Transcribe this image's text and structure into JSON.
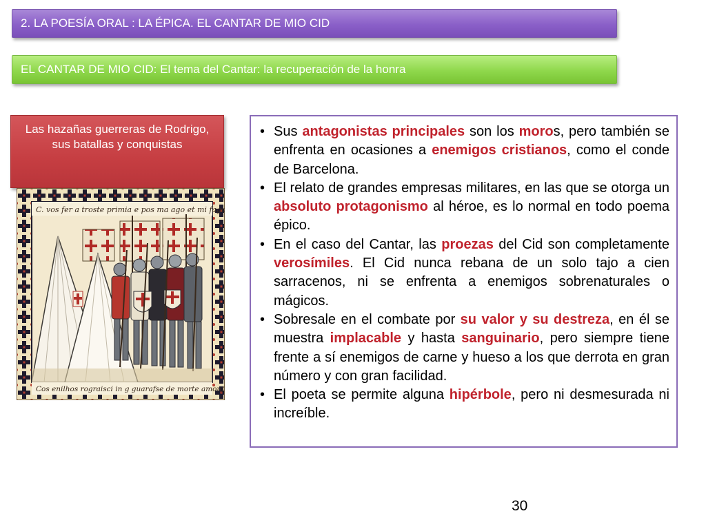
{
  "header": {
    "title": "2. LA POESÍA ORAL : LA ÉPICA. EL CANTAR DE MIO CID",
    "subtitle": "EL CANTAR DE MIO CID: El tema del Cantar: la recuperación de la honra"
  },
  "caption": "Las hazañas guerreras de Rodrigo, sus batallas y conquistas",
  "illustration": {
    "top_inscription": "C. vos fer a troste primia e pos ma ago et mi fago",
    "bottom_inscription": "Cos enilhos rograisci in g guarafse de morte amouf ie"
  },
  "bullets": [
    [
      {
        "t": "Sus "
      },
      {
        "t": "antagonistas principales",
        "hl": true
      },
      {
        "t": " son los "
      },
      {
        "t": "moro",
        "hl": true
      },
      {
        "t": "s, pero también se enfrenta en ocasiones a "
      },
      {
        "t": "enemigos cristianos",
        "hl": true
      },
      {
        "t": ", como el conde de Barcelona."
      }
    ],
    [
      {
        "t": "El relato de grandes empresas militares, en las que se otorga un "
      },
      {
        "t": "absoluto protagonismo",
        "hl": true
      },
      {
        "t": " al héroe, es lo normal en todo poema épico."
      }
    ],
    [
      {
        "t": "En el caso del Cantar, las "
      },
      {
        "t": "proezas",
        "hl": true
      },
      {
        "t": " del Cid son completamente "
      },
      {
        "t": "verosímiles",
        "hl": true
      },
      {
        "t": ". El Cid nunca rebana de un solo tajo a cien sarracenos, ni se enfrenta a enemigos sobrenaturales o mágicos."
      }
    ],
    [
      {
        "t": "Sobresale en el combate por "
      },
      {
        "t": "su valor y su destreza",
        "hl": true
      },
      {
        "t": ", en él se muestra "
      },
      {
        "t": "implacable",
        "hl": true
      },
      {
        "t": " y hasta "
      },
      {
        "t": "sanguinario",
        "hl": true
      },
      {
        "t": ", pero siempre tiene frente a sí enemigos de carne y hueso a los que derrota en gran número y con gran facilidad."
      }
    ],
    [
      {
        "t": "El poeta se permite alguna "
      },
      {
        "t": "hipérbole",
        "hl": true
      },
      {
        "t": ", pero ni desmesurada ni increíble."
      }
    ]
  ],
  "page_number": "30",
  "colors": {
    "title_banner": "#8a5fc8",
    "subtitle_banner": "#8fd84c",
    "caption_box": "#c63e42",
    "highlight": "#c0222c",
    "text_box_border": "#8a6cb8"
  }
}
